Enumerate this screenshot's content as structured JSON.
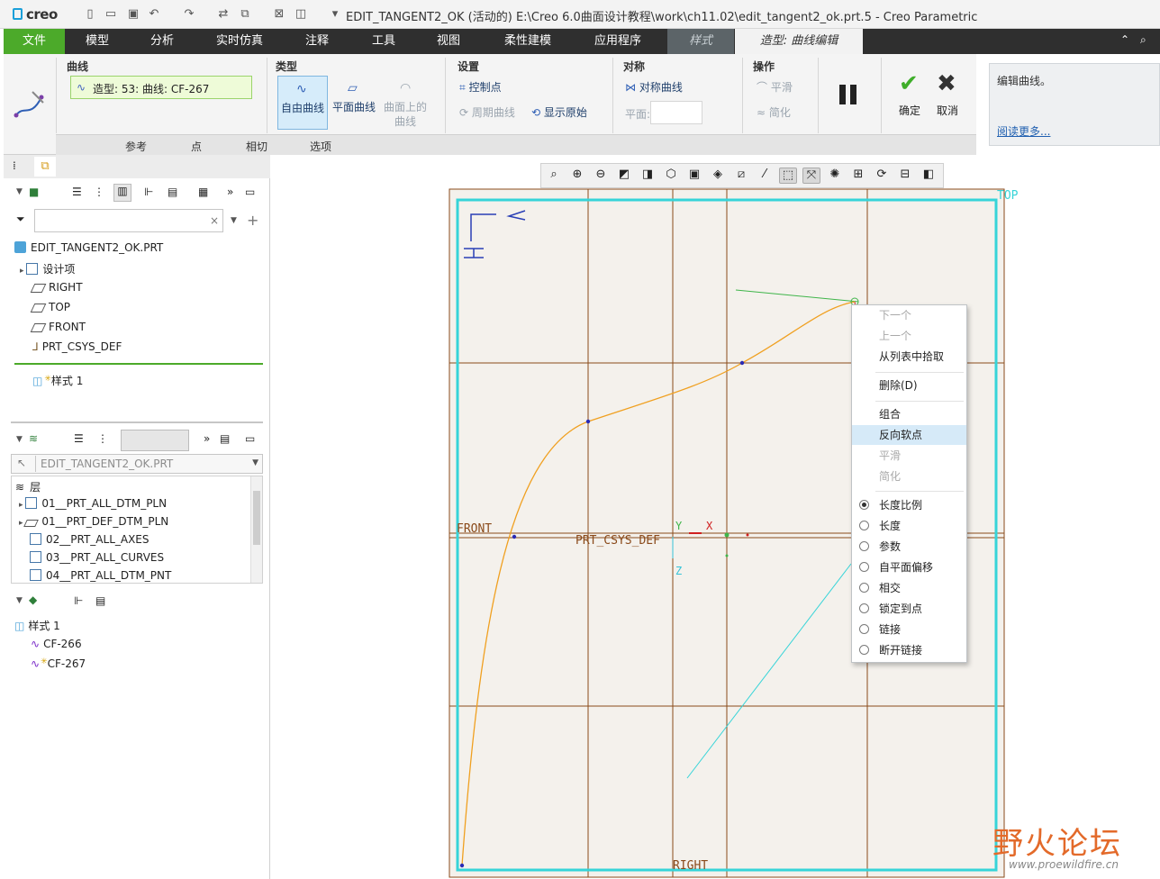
{
  "app": {
    "logo": "creo",
    "window_title": "EDIT_TANGENT2_OK (活动的) E:\\Creo 6.0曲面设计教程\\work\\ch11.02\\edit_tangent2_ok.prt.5 - Creo Parametric"
  },
  "menu": {
    "file": "文件",
    "model": "模型",
    "analysis": "分析",
    "simulation": "实时仿真",
    "annotate": "注释",
    "tools": "工具",
    "view": "视图",
    "flex": "柔性建模",
    "apps": "应用程序",
    "style": "样式",
    "curve_edit": "造型: 曲线编辑"
  },
  "ribbon": {
    "curve": {
      "label": "曲线",
      "value": "造型: 53: 曲线: CF-267"
    },
    "type": {
      "label": "类型",
      "free": "自由曲线",
      "planar": "平面曲线",
      "cos1": "曲面上的",
      "cos2": "曲线"
    },
    "settings": {
      "label": "设置",
      "control_points": "控制点",
      "periodic": "周期曲线",
      "show_original": "显示原始"
    },
    "symmetry": {
      "label": "对称",
      "sym_curve": "对称曲线",
      "plane_label": "平面:"
    },
    "operations": {
      "label": "操作",
      "smooth": "平滑",
      "simplify": "简化"
    },
    "ok": "确定",
    "cancel": "取消",
    "subtabs": [
      "参考",
      "点",
      "相切",
      "选项"
    ]
  },
  "help": {
    "text": "编辑曲线。",
    "link": "阅读更多..."
  },
  "model_tree": {
    "root": "EDIT_TANGENT2_OK.PRT",
    "items": [
      "设计项",
      "RIGHT",
      "TOP",
      "FRONT",
      "PRT_CSYS_DEF"
    ],
    "style_feature": "样式 1"
  },
  "layer_tree": {
    "model_select": "EDIT_TANGENT2_OK.PRT",
    "header": "层",
    "items": [
      "01__PRT_ALL_DTM_PLN",
      "01__PRT_DEF_DTM_PLN",
      "02__PRT_ALL_AXES",
      "03__PRT_ALL_CURVES",
      "04__PRT_ALL_DTM_PNT"
    ]
  },
  "style_tree": {
    "root": "样式 1",
    "items": [
      "CF-266",
      "CF-267"
    ]
  },
  "canvas": {
    "top_label": "TOP",
    "front_label": "FRONT",
    "right_label": "RIGHT",
    "csys_label": "PRT_CSYS_DEF",
    "axis_y": "Y",
    "axis_x": "X",
    "axis_z": "Z",
    "view_y": "Y",
    "view_x": "X"
  },
  "context_menu": {
    "items": [
      {
        "label": "下一个",
        "enabled": false
      },
      {
        "label": "上一个",
        "enabled": false
      },
      {
        "label": "从列表中拾取",
        "enabled": true
      },
      {
        "label": "删除(D)",
        "enabled": true
      },
      {
        "label": "组合",
        "enabled": true
      },
      {
        "label": "反向软点",
        "enabled": true,
        "highlighted": true
      },
      {
        "label": "平滑",
        "enabled": false
      },
      {
        "label": "简化",
        "enabled": false
      }
    ],
    "radio": [
      {
        "label": "长度比例",
        "checked": true
      },
      {
        "label": "长度",
        "checked": false
      },
      {
        "label": "参数",
        "checked": false
      },
      {
        "label": "自平面偏移",
        "checked": false
      },
      {
        "label": "相交",
        "checked": false
      },
      {
        "label": "锁定到点",
        "checked": false
      },
      {
        "label": "链接",
        "checked": false
      },
      {
        "label": "断开链接",
        "checked": false
      }
    ]
  },
  "watermark": {
    "text": "野火论坛",
    "url": "www.proewildfire.cn"
  },
  "colors": {
    "menu_bg": "#2f2f2f",
    "file_tab": "#4caa2a",
    "grid": "#8a4a1a",
    "frame": "#36d4d8",
    "curve": "#f0a020"
  }
}
